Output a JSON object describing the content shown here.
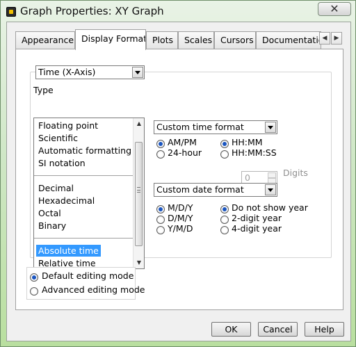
{
  "window": {
    "title": "Graph Properties: XY Graph",
    "close_label": "✕"
  },
  "tabs": [
    {
      "label": "Appearance"
    },
    {
      "label": "Display Format"
    },
    {
      "label": "Plots"
    },
    {
      "label": "Scales"
    },
    {
      "label": "Cursors"
    },
    {
      "label": "Documentatio"
    }
  ],
  "tab_scroll": {
    "left": "◀",
    "right": "▶"
  },
  "axis_select": {
    "value": "Time (X-Axis)"
  },
  "type_section": {
    "label": "Type",
    "items": [
      "Floating point",
      "Scientific",
      "Automatic formatting",
      "SI notation",
      "Decimal",
      "Hexadecimal",
      "Octal",
      "Binary",
      "Absolute time",
      "Relative time"
    ],
    "selected": "Absolute time"
  },
  "time_format": {
    "select_value": "Custom time format",
    "options": [
      {
        "label": "AM/PM",
        "checked": true
      },
      {
        "label": "24-hour",
        "checked": false
      },
      {
        "label": "HH:MM",
        "checked": true
      },
      {
        "label": "HH:MM:SS",
        "checked": false
      }
    ]
  },
  "digits": {
    "value": "0",
    "label": "Digits"
  },
  "date_format": {
    "select_value": "Custom date format",
    "options": [
      {
        "label": "M/D/Y",
        "checked": true
      },
      {
        "label": "D/M/Y",
        "checked": false
      },
      {
        "label": "Y/M/D",
        "checked": false
      },
      {
        "label": "Do not show year",
        "checked": true
      },
      {
        "label": "2-digit year",
        "checked": false
      },
      {
        "label": "4-digit year",
        "checked": false
      }
    ]
  },
  "editing_mode": {
    "options": [
      {
        "label": "Default editing mode",
        "checked": true
      },
      {
        "label": "Advanced editing mode",
        "checked": false
      }
    ]
  },
  "buttons": {
    "ok": "OK",
    "cancel": "Cancel",
    "help": "Help"
  }
}
